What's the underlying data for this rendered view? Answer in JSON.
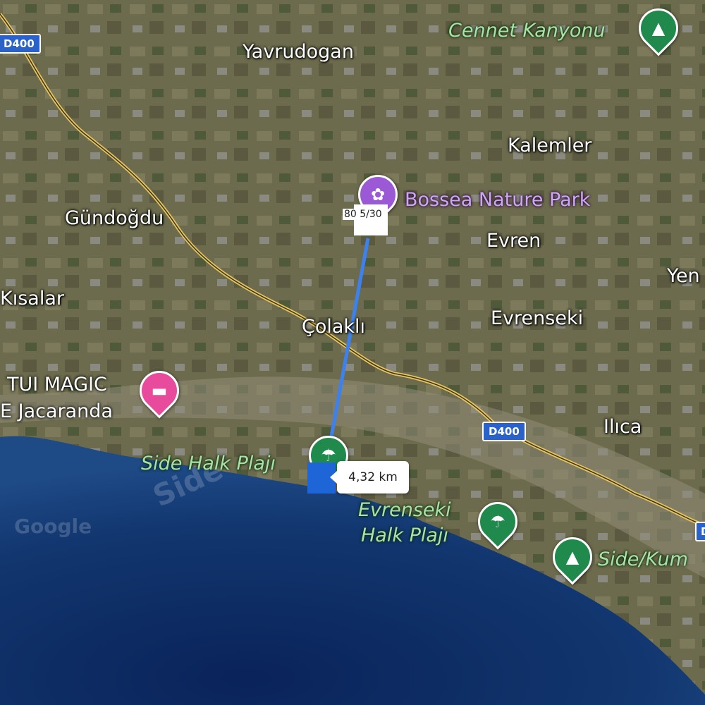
{
  "labels": {
    "yavrudogan": "Yavrudogan",
    "cennet_kanyonu": "Cennet Kanyonu",
    "kalemler": "Kalemler",
    "gundogdu": "Gündoğdu",
    "bossea": "Bossea Nature Park",
    "evren": "Evren",
    "yen": "Yen",
    "kisalar": "Kısalar",
    "colakli": "Çolaklı",
    "evrenseki": "Evrenseki",
    "tui_line1": "TUI MAGIC",
    "tui_line2": "E Jacaranda",
    "ilica": "Ilıca",
    "side_halk": "Side Halk Plajı",
    "evrenseki_halk_line1": "Evrenseki",
    "evrenseki_halk_line2": "Halk Plajı",
    "side_kum": "Side/Kum"
  },
  "road_shields": {
    "top_left": "D400",
    "middle": "D400",
    "right_edge": "D"
  },
  "measure": {
    "distance": "4,32 km",
    "start_tag": "80 5/30"
  },
  "watermarks": {
    "google": "Google",
    "side": "Side"
  },
  "icons": {
    "park": "tree-icon",
    "bossea": "flower-icon",
    "hotel": "bed-icon",
    "beach": "umbrella-icon"
  },
  "colors": {
    "sea_deep": "#0d2a63",
    "sea_shallow": "#1e4a86",
    "land": "#6b6a4c",
    "road": "#e8c55a",
    "route_line": "#3b82f0",
    "park_pin": "#1f8a4c",
    "poi_pin": "#9b59d6",
    "hotel_pin": "#e84a9c",
    "shield": "#2a62c9"
  }
}
